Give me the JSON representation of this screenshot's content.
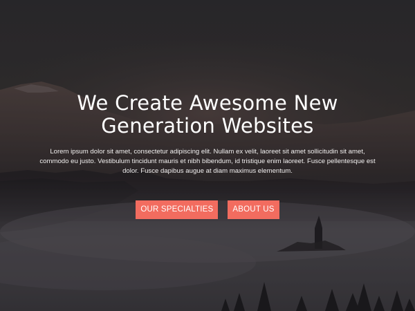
{
  "hero": {
    "title_line_1": "We Create Awesome New",
    "title_line_2": "Generation Websites",
    "description": "Lorem ipsum dolor sit amet, consectetur adipiscing elit. Nullam ex velit, laoreet sit amet sollicitudin sit amet, commodo eu justo. Vestibulum tincidunt mauris et nibh bibendum, id tristique enim laoreet. Fusce pellentesque est dolor. Fusce dapibus augue at diam maximus elementum.",
    "buttons": {
      "specialties_label": "OUR SPECIALTIES",
      "about_label": "ABOUT US"
    }
  },
  "colors": {
    "accent": "#f26c5f",
    "text": "#ffffff"
  }
}
